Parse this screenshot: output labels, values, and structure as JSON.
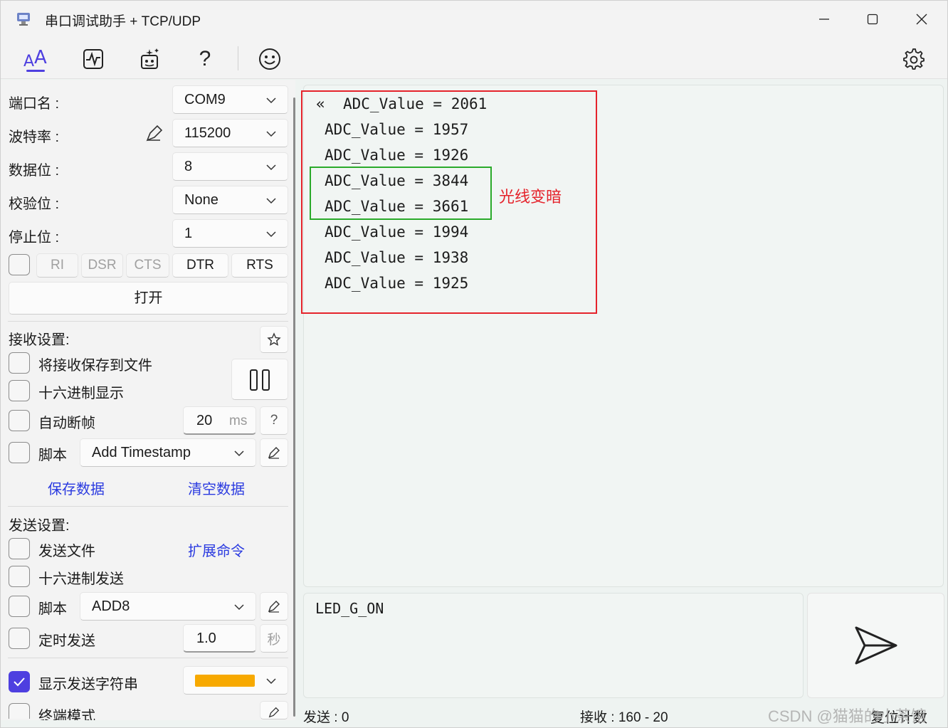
{
  "window": {
    "title": "串口调试助手 + TCP/UDP"
  },
  "toolbar": {
    "items": [
      "text-mode-icon",
      "waveform-icon",
      "magic-icon",
      "help-icon",
      "smiley-icon"
    ],
    "help_label": "?"
  },
  "serial": {
    "port_label": "端口名 :",
    "port_value": "COM9",
    "baud_label": "波特率 :",
    "baud_value": "115200",
    "databits_label": "数据位 :",
    "databits_value": "8",
    "parity_label": "校验位 :",
    "parity_value": "None",
    "stopbits_label": "停止位 :",
    "stopbits_value": "1",
    "signals": [
      "RI",
      "DSR",
      "CTS",
      "DTR",
      "RTS"
    ],
    "open_label": "打开"
  },
  "receive_settings": {
    "title": "接收设置:",
    "save_to_file": "将接收保存到文件",
    "hex_display": "十六进制显示",
    "auto_frame": "自动断帧",
    "frame_value": "20",
    "frame_unit": "ms",
    "help": "?",
    "script_label": "脚本",
    "script_value": "Add Timestamp",
    "save_data": "保存数据",
    "clear_data": "清空数据"
  },
  "send_settings": {
    "title": "发送设置:",
    "send_file": "发送文件",
    "ext_command": "扩展命令",
    "hex_send": "十六进制发送",
    "script_label": "脚本",
    "script_value": "ADD8",
    "timed_send": "定时发送",
    "interval_value": "1.0",
    "interval_unit": "秒",
    "show_send_string": "显示发送字符串",
    "show_send_checked": true,
    "color_value": "#f7a900",
    "terminal_mode": "终端模式"
  },
  "receive": {
    "first_marker": "«",
    "lines": [
      "ADC_Value = 2061",
      "ADC_Value = 1957",
      "ADC_Value = 1926",
      "ADC_Value = 3844",
      "ADC_Value = 3661",
      "ADC_Value = 1994",
      "ADC_Value = 1938",
      "ADC_Value = 1925"
    ],
    "annotation": "光线变暗"
  },
  "send": {
    "text": "LED_G_ON"
  },
  "status": {
    "sent_label": "发送 : 0",
    "recv_label": "接收 : 160  -  20",
    "reset_label": "复位计数"
  },
  "watermark": "CSDN @猫猫的小茶馆",
  "colors": {
    "accent": "#4e3fe0",
    "link": "#2a3ae0",
    "annotation_red": "#e5232b",
    "annotation_green": "#2aaa2a"
  }
}
